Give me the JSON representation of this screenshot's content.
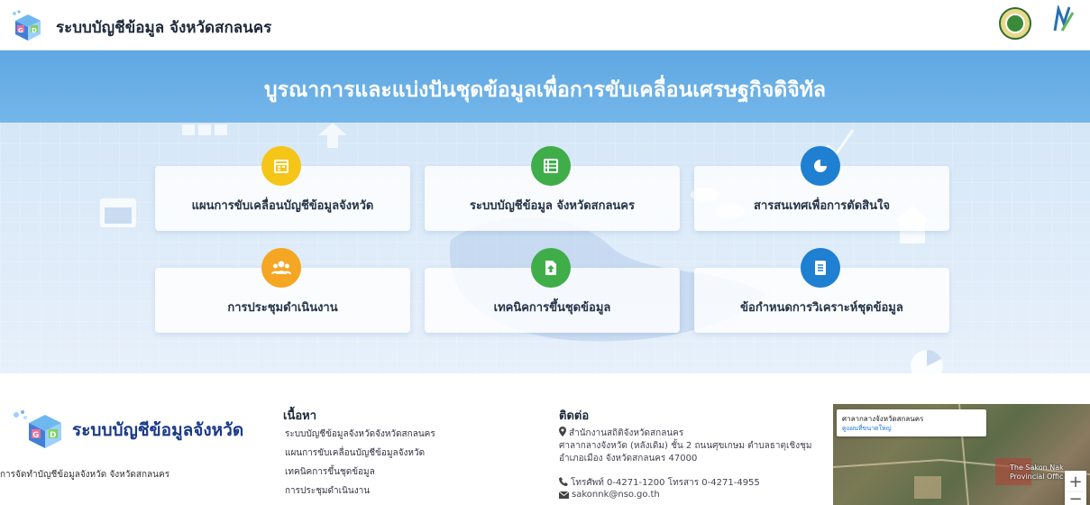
{
  "header": {
    "title": "ระบบบัญชีข้อมูล จังหวัดสกลนคร",
    "logo_icon": "gd-cube-logo-icon",
    "seal_left_icon": "provincial-seal-icon",
    "seal_right_icon": "nso-logo-icon"
  },
  "hero": {
    "title": "บูรณาการและแบ่งปันชุดข้อมูลเพื่อการขับเคลื่อนเศรษฐกิจดิจิทัล"
  },
  "cards": [
    {
      "label": "แผนการขับเคลื่อนบัญชีข้อมูลจังหวัด",
      "icon": "calendar-icon",
      "color": "#f5c518"
    },
    {
      "label": "ระบบบัญชีข้อมูล จังหวัดสกลนคร",
      "icon": "table-list-icon",
      "color": "#3fae49"
    },
    {
      "label": "สารสนเทศเพื่อการตัดสินใจ",
      "icon": "pie-chart-icon",
      "color": "#1f7fd1"
    },
    {
      "label": "การประชุมดำเนินงาน",
      "icon": "users-icon",
      "color": "#f5a623"
    },
    {
      "label": "เทคนิคการขึ้นชุดข้อมูล",
      "icon": "file-upload-icon",
      "color": "#3fae49"
    },
    {
      "label": "ข้อกำหนดการวิเคราะห์ชุดข้อมูล",
      "icon": "document-icon",
      "color": "#1f7fd1"
    }
  ],
  "footer": {
    "logo_text": "ระบบบัญชีข้อมูลจังหวัด",
    "subtitle": "การจัดทำบัญชีข้อมูลจังหวัด จังหวัดสกลนคร",
    "content_title": "เนื้อหา",
    "content_links": [
      "ระบบบัญชีข้อมูลจังหวัดจังหวัดสกลนคร",
      "แผนการขับเคลื่อนบัญชีข้อมูลจังหวัด",
      "เทคนิคการขึ้นชุดข้อมูล",
      "การประชุมดำเนินงาน"
    ],
    "contact_title": "ติดต่อ",
    "office": "สำนักงานสถิติจังหวัดสกลนคร",
    "address_1": "ศาลากลางจังหวัด (หลังเดิม) ชั้น 2 ถนนศุขเกษม ตำบลธาตุเชิงชุม",
    "address_2": "อำเภอเมือง จังหวัดสกลนคร 47000",
    "phone": "โทรศัพท์ 0-4271-1200 โทรสาร 0-4271-4955",
    "email": "sakonnk@nso.go.th"
  },
  "map": {
    "popup_title": "ศาลากลางจังหวัดสกลนคร",
    "popup_link": "ดูแผนที่ขนาดใหญ่",
    "label_1": "The Sakon Nak",
    "label_2": "Provincial Offic",
    "zoom_in": "+",
    "zoom_out": "−"
  }
}
